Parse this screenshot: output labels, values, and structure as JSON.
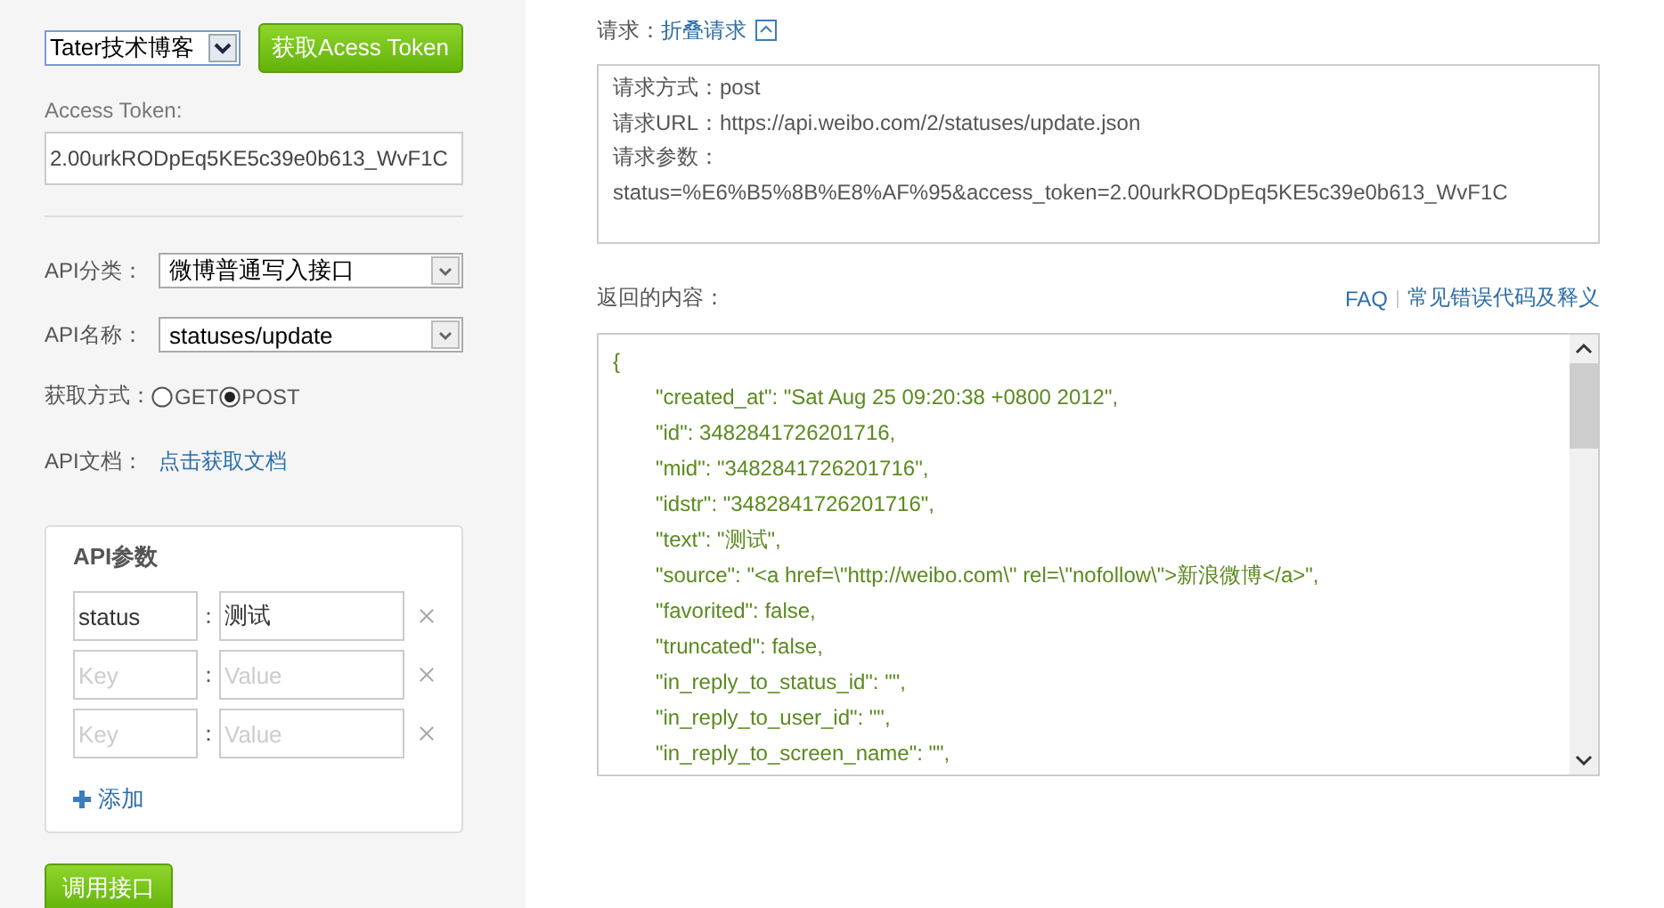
{
  "sidebar": {
    "app_select": "Tater技术博客",
    "token_button": "获取Acess Token",
    "token_label": "Access Token:",
    "token_value": "2.00urkRODpEq5KE5c39e0b613_WvF1C",
    "category_label": "API分类：",
    "category_value": "微博普通写入接口",
    "name_label": "API名称：",
    "name_value": "statuses/update",
    "method_label": "获取方式：",
    "methods": [
      {
        "label": "GET",
        "selected": false
      },
      {
        "label": "POST",
        "selected": true
      }
    ],
    "doc_label": "API文档：",
    "doc_link": "点击获取文档",
    "params": {
      "title": "API参数",
      "separator": "：",
      "rows": [
        {
          "key": "status",
          "value": "测试"
        },
        {
          "key_placeholder": "Key",
          "value_placeholder": "Value"
        },
        {
          "key_placeholder": "Key",
          "value_placeholder": "Value"
        }
      ],
      "add_label": "添加"
    },
    "call_button": "调用接口"
  },
  "request": {
    "label": "请求：",
    "collapse_link": "折叠请求",
    "lines": [
      "请求方式：post",
      "请求URL：https://api.weibo.com/2/statuses/update.json",
      "请求参数：",
      "status=%E6%B5%8B%E8%AF%95&access_token=2.00urkRODpEq5KE5c39e0b613_WvF1C"
    ]
  },
  "response": {
    "label": "返回的内容：",
    "links": [
      "FAQ",
      "常见错误代码及释义"
    ],
    "lines": [
      {
        "text": "{",
        "children": [
          {
            "text": "\"created_at\": \"Sat Aug 25 09:20:38 +0800 2012\","
          },
          {
            "text": "\"id\": 3482841726201716,"
          },
          {
            "text": "\"mid\": \"3482841726201716\","
          },
          {
            "text": "\"idstr\": \"3482841726201716\","
          },
          {
            "text": "\"text\": \"测试\","
          },
          {
            "text": "\"source\": \"<a href=\\\"http://weibo.com\\\" rel=\\\"nofollow\\\">新浪微博</a>\","
          },
          {
            "text": "\"favorited\": false,"
          },
          {
            "text": "\"truncated\": false,"
          },
          {
            "text": "\"in_reply_to_status_id\": \"\","
          },
          {
            "text": "\"in_reply_to_user_id\": \"\","
          },
          {
            "text": "\"in_reply_to_screen_name\": \"\","
          }
        ]
      }
    ]
  }
}
